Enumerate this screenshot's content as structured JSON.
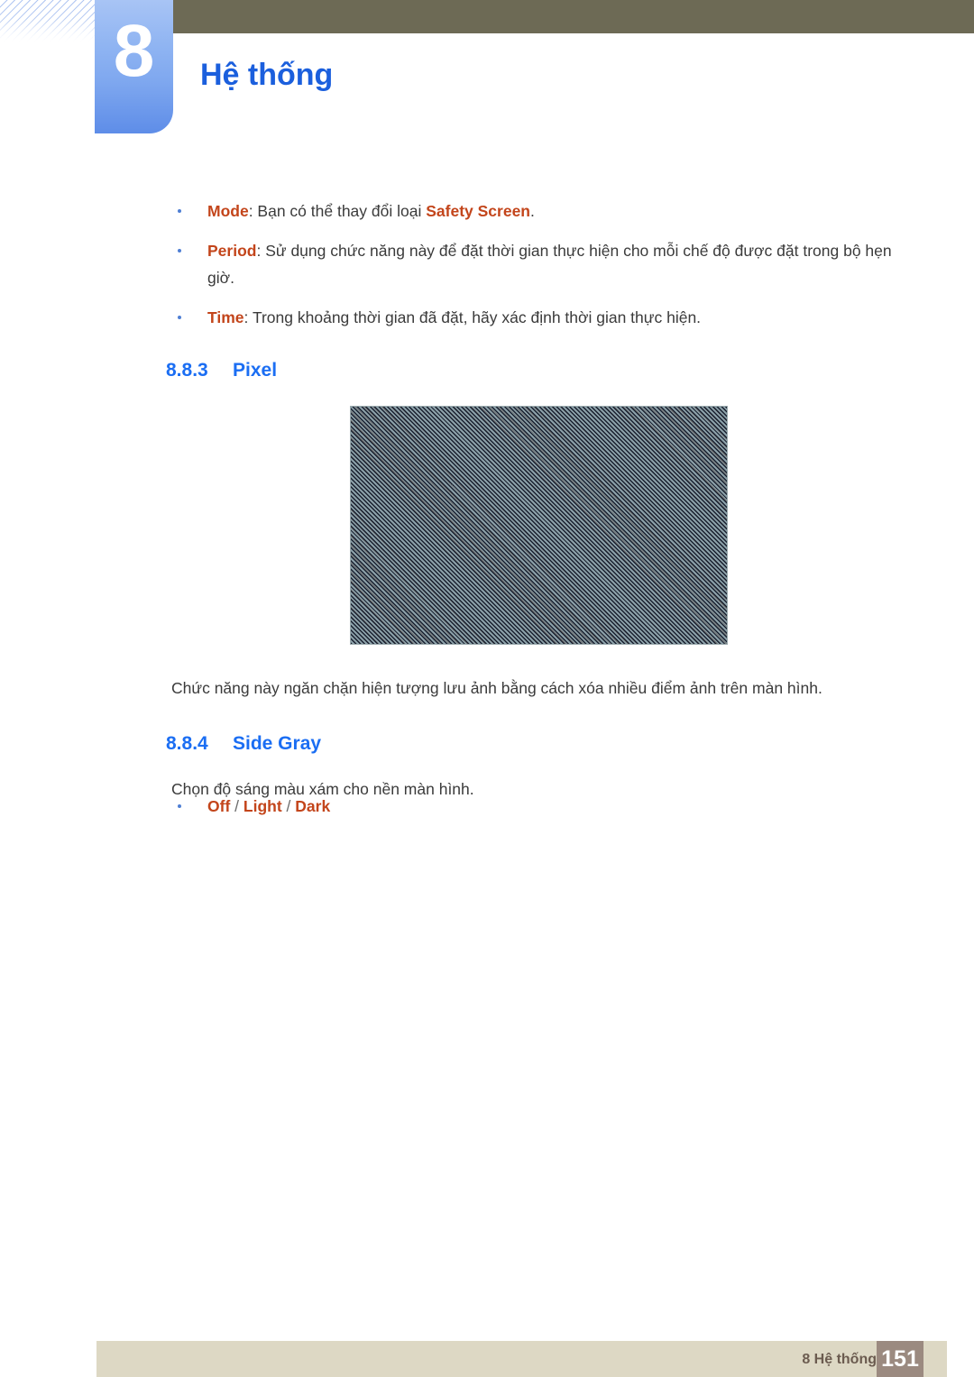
{
  "header": {
    "chapter_number": "8",
    "chapter_title": "Hệ thống",
    "accent_color": "#1b5fdd",
    "tab_color": "#8fb4f2",
    "olive_bar_color": "#6d6a55"
  },
  "bullets_top": [
    {
      "label": "Mode",
      "text_before": ": Bạn có thể thay đổi loại ",
      "emphasis": "Safety Screen",
      "text_after": "."
    },
    {
      "label": "Period",
      "text_before": ": Sử dụng chức năng này để đặt thời gian thực hiện cho mỗi chế độ được đặt trong bộ hẹn giờ.",
      "emphasis": "",
      "text_after": ""
    },
    {
      "label": "Time",
      "text_before": ": Trong khoảng thời gian đã đặt, hãy xác định thời gian thực hiện.",
      "emphasis": "",
      "text_after": ""
    }
  ],
  "section_883": {
    "number": "8.8.3",
    "title": "Pixel",
    "figure_alt": "pixel-shift-pattern",
    "paragraph": "Chức năng này ngăn chặn hiện tượng lưu ảnh bằng cách xóa nhiều điểm ảnh trên màn hình."
  },
  "section_884": {
    "number": "8.8.4",
    "title": "Side Gray",
    "paragraph": "Chọn độ sáng màu xám cho nền màn hình.",
    "options": {
      "off": "Off",
      "sep1": "/",
      "light": "Light",
      "sep2": "/",
      "dark": "Dark"
    }
  },
  "footer": {
    "text": "8 Hệ thống",
    "page_number": "151",
    "bar_color": "#ddd8c4",
    "page_box_color": "#9b8a80"
  }
}
